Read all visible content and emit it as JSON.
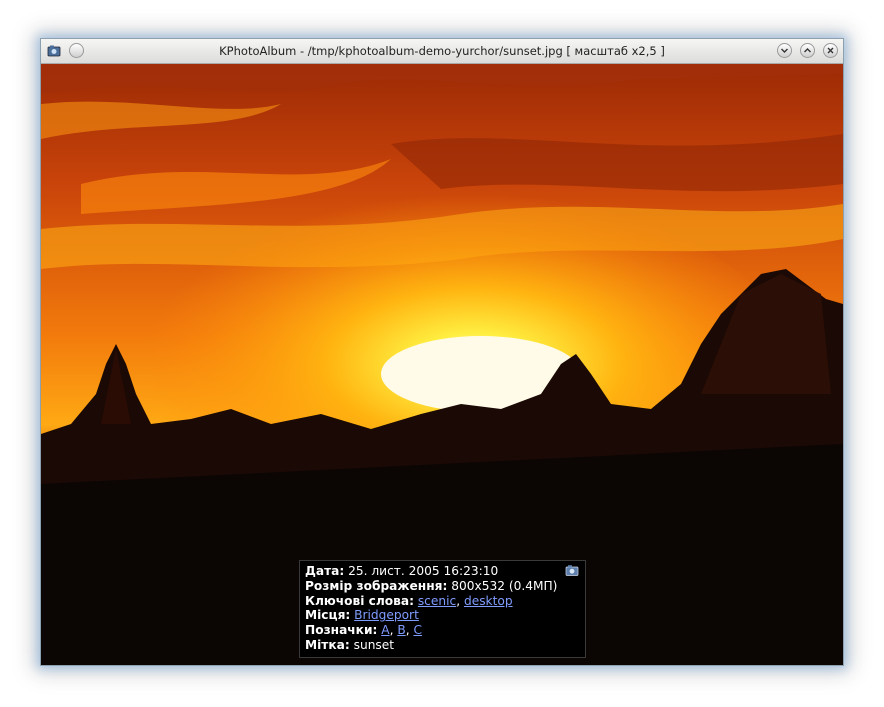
{
  "window": {
    "title": "KPhotoAlbum - /tmp/kphotoalbum-demo-yurchor/sunset.jpg [ масштаб x2,5 ]",
    "buttons": {
      "minimize_icon": "chevron-down",
      "maximize_icon": "chevron-up",
      "close_icon": "close-x"
    }
  },
  "photo": {
    "description": "sunset"
  },
  "info": {
    "date_label": "Дата:",
    "date_value": "25. лист. 2005 16:23:10",
    "size_label": "Розмір зображення:",
    "size_value": "800x532 (0.4МП)",
    "keywords_label": "Ключові слова:",
    "keywords": [
      "scenic",
      "desktop"
    ],
    "places_label": "Місця:",
    "places": [
      "Bridgeport"
    ],
    "tags_label": "Позначки:",
    "tags": [
      "A",
      "B",
      "C"
    ],
    "label_label": "Мітка:",
    "label_value": "sunset"
  },
  "colors": {
    "link": "#7f9cff",
    "sky_dark": "#b83a05",
    "sky_mid": "#f57a0a",
    "sun": "#fffbe8"
  }
}
